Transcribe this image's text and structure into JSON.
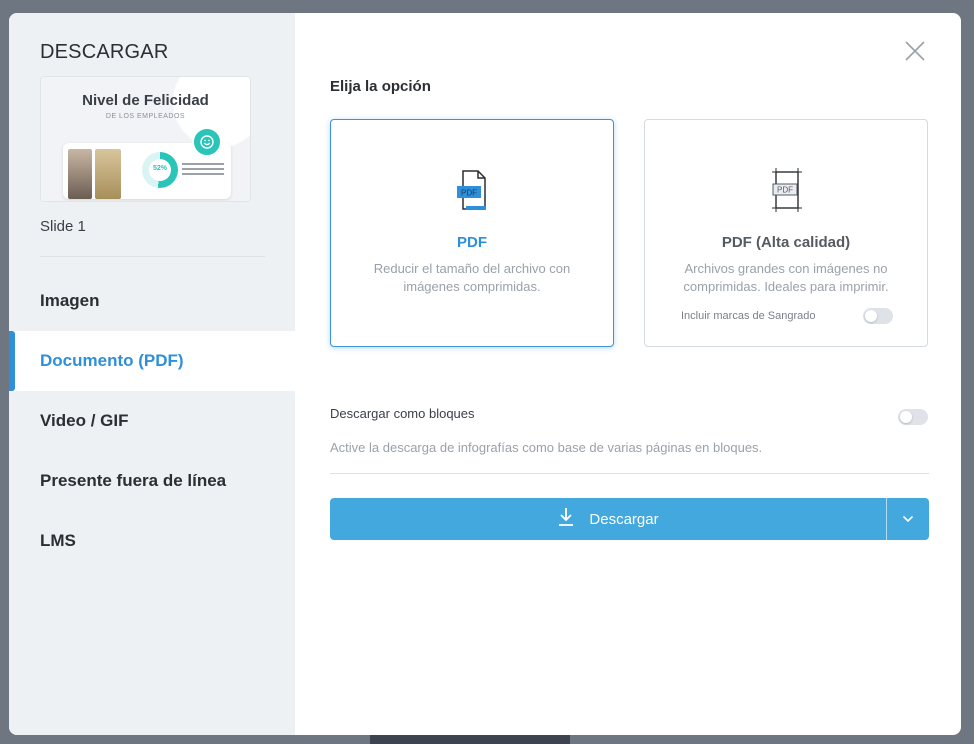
{
  "sidebar": {
    "title": "DESCARGAR",
    "thumbnail": {
      "title": "Nivel de Felicidad",
      "subtitle": "DE LOS EMPLEADOS",
      "percent": "52%"
    },
    "slide_label": "Slide 1",
    "items": [
      {
        "label": "Imagen",
        "active": false
      },
      {
        "label": "Documento (PDF)",
        "active": true
      },
      {
        "label": "Video / GIF",
        "active": false
      },
      {
        "label": "Presente fuera de línea",
        "active": false
      },
      {
        "label": "LMS",
        "active": false
      }
    ]
  },
  "main": {
    "section_title": "Elija la opción",
    "options": [
      {
        "icon": "pdf-file-icon",
        "title": "PDF",
        "description": "Reducir el tamaño del archivo con imágenes comprimidas.",
        "selected": true
      },
      {
        "icon": "pdf-bleed-icon",
        "title": "PDF (Alta calidad)",
        "description": "Archivos grandes con imágenes no comprimidas. Ideales para imprimir.",
        "selected": false,
        "bleed_label": "Incluir marcas de Sangrado",
        "bleed_enabled": false
      }
    ],
    "blocks": {
      "label": "Descargar como bloques",
      "description": "Active la descarga de infografías como base de varias páginas en bloques.",
      "enabled": false
    },
    "download": {
      "label": "Descargar",
      "icon": "download-icon",
      "caret_icon": "chevron-down-icon"
    },
    "close_icon": "close-icon"
  },
  "colors": {
    "accent": "#2f8fd8",
    "button": "#42a8de",
    "sidebar_bg": "#eef1f4"
  }
}
